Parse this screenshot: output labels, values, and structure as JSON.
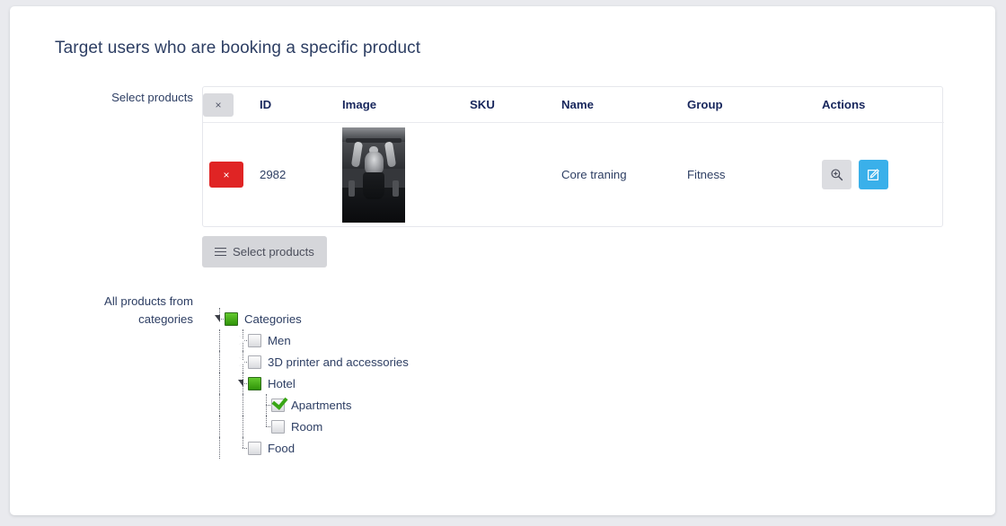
{
  "page": {
    "title": "Target users who are booking a specific product"
  },
  "fields": {
    "select_products_label": "Select products",
    "all_products_label_line1": "All products from",
    "all_products_label_line2": "categories"
  },
  "products_table": {
    "header_clear_label": "×",
    "columns": {
      "x": "",
      "id": "ID",
      "image": "Image",
      "sku": "SKU",
      "name": "Name",
      "group": "Group",
      "actions": "Actions"
    },
    "rows": [
      {
        "delete_label": "×",
        "id": "2982",
        "image_alt": "bodybuilder-pullup-photo",
        "sku": "",
        "name": "Core traning",
        "group": "Fitness",
        "action_zoom": "zoom-in-icon",
        "action_edit": "edit-square-icon"
      }
    ]
  },
  "buttons": {
    "select_products": "Select products"
  },
  "tree": {
    "nodes": [
      {
        "label": "Categories",
        "state": "partial",
        "expander": "open",
        "depth": 0
      },
      {
        "label": "Men",
        "state": "unchecked",
        "expander": "closed",
        "depth": 1
      },
      {
        "label": "3D printer and accessories",
        "state": "unchecked",
        "expander": "closed",
        "depth": 1
      },
      {
        "label": "Hotel",
        "state": "partial",
        "expander": "open",
        "depth": 1
      },
      {
        "label": "Apartments",
        "state": "checked",
        "expander": "none",
        "depth": 2
      },
      {
        "label": "Room",
        "state": "unchecked",
        "expander": "none",
        "depth": 2
      },
      {
        "label": "Food",
        "state": "unchecked",
        "expander": "none",
        "depth": 1
      }
    ]
  },
  "colors": {
    "accent_blue": "#3ab0ea",
    "danger_red": "#e02424",
    "text_navy": "#2d3e63",
    "tree_green": "#39a615",
    "page_bg": "#e9eaee"
  }
}
